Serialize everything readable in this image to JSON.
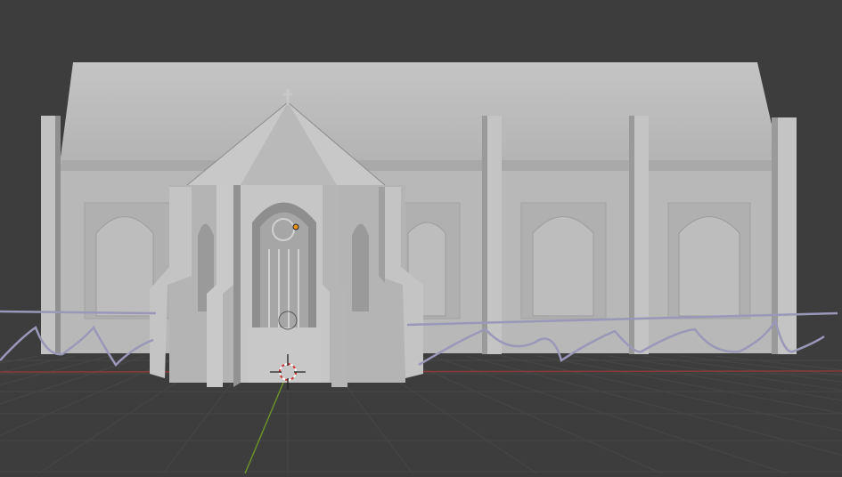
{
  "viewport": {
    "background_color": "#3d3d3d",
    "grid_color": "#474747",
    "x_axis_color": "#8a3a3a",
    "y_axis_color": "#6a8f2a",
    "model_color": "#bdbdbd",
    "curve_color": "#9a98b8",
    "cursor_color": "#d03030",
    "origin_color": "#f0901a"
  }
}
